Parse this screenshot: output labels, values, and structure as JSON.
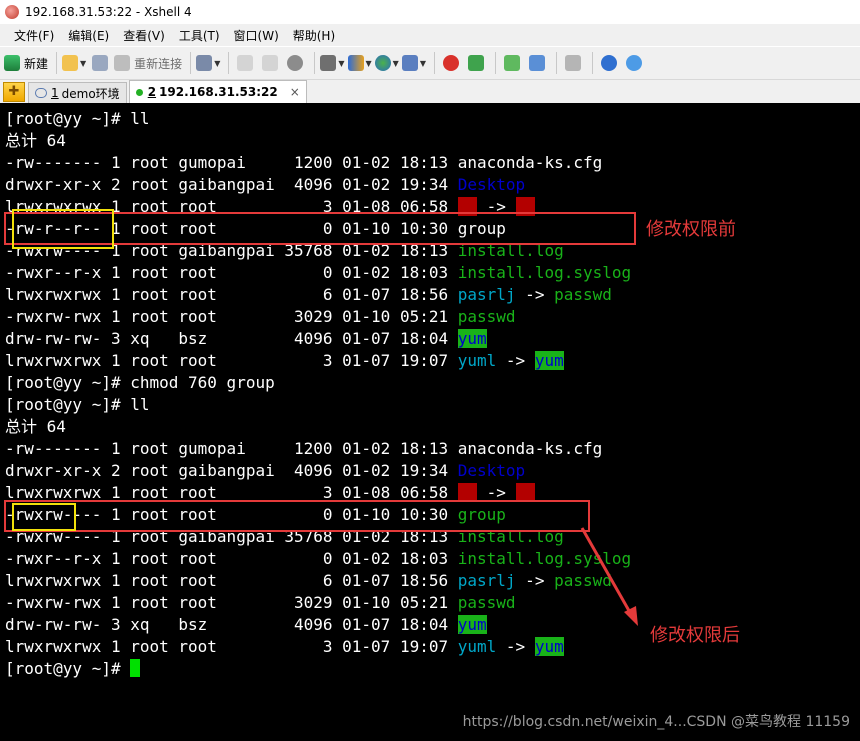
{
  "window": {
    "title": "192.168.31.53:22 - Xshell 4"
  },
  "menu": [
    "文件(F)",
    "编辑(E)",
    "查看(V)",
    "工具(T)",
    "窗口(W)",
    "帮助(H)"
  ],
  "toolbar": {
    "new_label": "新建",
    "reconnect_label": "重新连接"
  },
  "tabs": [
    {
      "number": "1",
      "label": "demo环境"
    },
    {
      "number": "2",
      "label": "192.168.31.53:22",
      "close": "×"
    }
  ],
  "terminal": {
    "lines": [
      "[root@yy ~]# ll",
      "总计 64",
      "-rw------- 1 root gumopai     1200 01-02 18:13 anaconda-ks.cfg",
      "drwxr-xr-x 2 root gaibangpai  4096 01-02 19:34 ",
      "lrwxrwxrwx 1 root root           3 01-08 06:58 ",
      "-rw-r--r-- 1 root root           0 01-10 10:30 group",
      "-rwxrw---- 1 root gaibangpai 35768 01-02 18:13 ",
      "-rwxr--r-x 1 root root           0 01-02 18:03 ",
      "lrwxrwxrwx 1 root root           6 01-07 18:56 ",
      "-rwxrw-rwx 1 root root        3029 01-10 05:21 ",
      "drw-rw-rw- 3 xq   bsz         4096 01-07 18:04 ",
      "lrwxrwxrwx 1 root root           3 01-07 19:07 ",
      "[root@yy ~]# chmod 760 group",
      "[root@yy ~]# ll",
      "总计 64",
      "-rw------- 1 root gumopai     1200 01-02 18:13 anaconda-ks.cfg",
      "drwxr-xr-x 2 root gaibangpai  4096 01-02 19:34 ",
      "lrwxrwxrwx 1 root root           3 01-08 06:58 ",
      "-rwxrw---- 1 root root           0 01-10 10:30 ",
      "-rwxrw---- 1 root gaibangpai 35768 01-02 18:13 ",
      "-rwxr--r-x 1 root root           0 01-02 18:03 ",
      "lrwxrwxrwx 1 root root           6 01-07 18:56 ",
      "-rwxrw-rwx 1 root root        3029 01-10 05:21 ",
      "drw-rw-rw- 3 xq   bsz         4096 01-07 18:04 ",
      "lrwxrwxrwx 1 root root           3 01-07 19:07 ",
      "[root@yy ~]# "
    ],
    "names": {
      "desktop": "Desktop",
      "install_log": "install.log",
      "install_syslog": "install.log.syslog",
      "pasrlj": "pasrlj",
      "passwd": "passwd",
      "yum": "yum",
      "yuml": "yuml",
      "group": "group",
      "arrow": " -> ",
      "link_block": "xx"
    }
  },
  "annotations": {
    "before": "修改权限前",
    "after": "修改权限后"
  },
  "watermark": "https://blog.csdn.net/weixin_4...CSDN @菜鸟教程 11159"
}
